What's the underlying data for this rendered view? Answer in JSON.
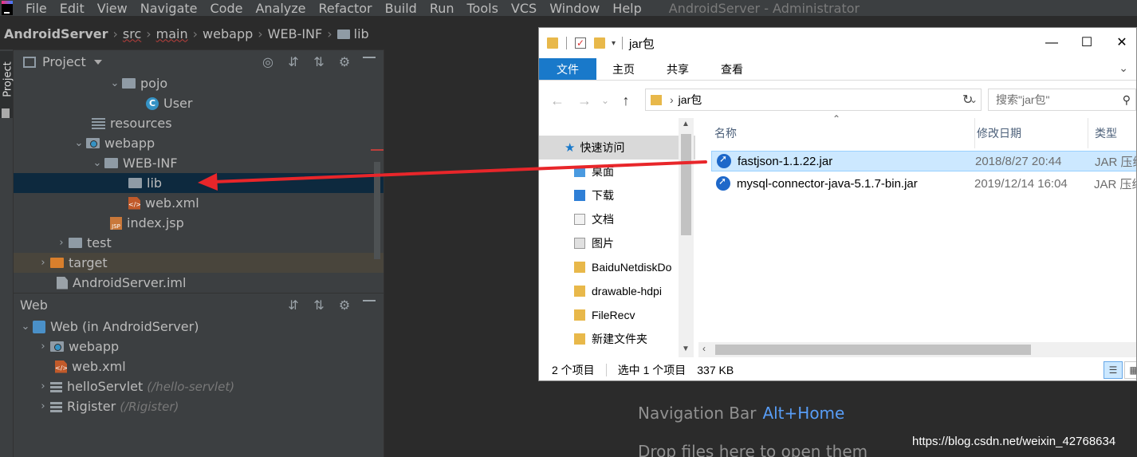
{
  "ide": {
    "menu": [
      "File",
      "Edit",
      "View",
      "Navigate",
      "Code",
      "Analyze",
      "Refactor",
      "Build",
      "Run",
      "Tools",
      "VCS",
      "Window",
      "Help"
    ],
    "window_title": "AndroidServer - Administrator",
    "breadcrumb": [
      "AndroidServer",
      "src",
      "main",
      "webapp",
      "WEB-INF",
      "lib"
    ],
    "side_tab": "Project",
    "project_panel": {
      "title": "Project",
      "tree": [
        {
          "label": "pojo",
          "icon": "folder-icon",
          "expanded": true
        },
        {
          "label": "User",
          "icon": "class-icon",
          "glyph": "C"
        },
        {
          "label": "resources",
          "icon": "resources-folder-icon"
        },
        {
          "label": "webapp",
          "icon": "web-folder-icon",
          "expanded": true
        },
        {
          "label": "WEB-INF",
          "icon": "folder-icon",
          "expanded": true
        },
        {
          "label": "lib",
          "icon": "folder-icon",
          "selected": true
        },
        {
          "label": "web.xml",
          "icon": "xml-file-icon"
        },
        {
          "label": "index.jsp",
          "icon": "jsp-file-icon",
          "glyph": "JSP"
        },
        {
          "label": "test",
          "icon": "folder-icon",
          "expanded": false
        },
        {
          "label": "target",
          "icon": "excluded-folder-icon",
          "expanded": false
        },
        {
          "label": "AndroidServer.iml",
          "icon": "module-file-icon"
        }
      ]
    },
    "web_panel": {
      "title": "Web",
      "tree": [
        {
          "label": "Web (in AndroidServer)",
          "hint": "",
          "icon": "web-facet-icon",
          "expanded": true
        },
        {
          "label": "webapp",
          "hint": "",
          "icon": "web-folder-icon",
          "expanded": false
        },
        {
          "label": "web.xml",
          "hint": "",
          "icon": "xml-file-icon"
        },
        {
          "label": "helloServlet",
          "hint": "(/hello-servlet)",
          "icon": "servlet-icon",
          "expanded": false
        },
        {
          "label": "Rigister",
          "hint": "(/Rigister)",
          "icon": "servlet-icon",
          "expanded": false
        }
      ]
    },
    "editor_hints": {
      "nav_label": "Navigation Bar",
      "nav_key": "Alt+Home",
      "drop_label": "Drop files here to open them"
    },
    "colors": {
      "ide_bg": "#3c3f41",
      "editor_bg": "#2b2b2b",
      "selection": "#0d293e",
      "accent_blue": "#589df6",
      "arrow_red": "#e8262a"
    }
  },
  "explorer": {
    "title": "jar包",
    "ribbon_tabs": [
      "文件",
      "主页",
      "共享",
      "查看"
    ],
    "address_path": "jar包",
    "search_placeholder": "搜索\"jar包\"",
    "nav_items": [
      {
        "label": "快速访问",
        "icon": "star-icon",
        "pinned": false,
        "selected": true
      },
      {
        "label": "桌面",
        "icon": "desktop-icon",
        "pinned": true
      },
      {
        "label": "下载",
        "icon": "download-icon",
        "pinned": true
      },
      {
        "label": "文档",
        "icon": "documents-icon",
        "pinned": true
      },
      {
        "label": "图片",
        "icon": "pictures-icon",
        "pinned": true
      },
      {
        "label": "BaiduNetdiskDo",
        "icon": "folder-icon",
        "pinned": false
      },
      {
        "label": "drawable-hdpi",
        "icon": "folder-icon",
        "pinned": false
      },
      {
        "label": "FileRecv",
        "icon": "folder-icon",
        "pinned": false
      },
      {
        "label": "新建文件夹",
        "icon": "folder-icon",
        "pinned": false
      }
    ],
    "columns": {
      "name": "名称",
      "date": "修改日期",
      "type": "类型"
    },
    "files": [
      {
        "name": "fastjson-1.1.22.jar",
        "date": "2018/8/27 20:44",
        "type": "JAR 压缩",
        "selected": true
      },
      {
        "name": "mysql-connector-java-5.1.7-bin.jar",
        "date": "2019/12/14 16:04",
        "type": "JAR 压缩",
        "selected": false
      }
    ],
    "status": {
      "count": "2 个项目",
      "selection": "选中 1 个项目",
      "size": "337 KB"
    }
  },
  "watermark": "https://blog.csdn.net/weixin_42768634"
}
